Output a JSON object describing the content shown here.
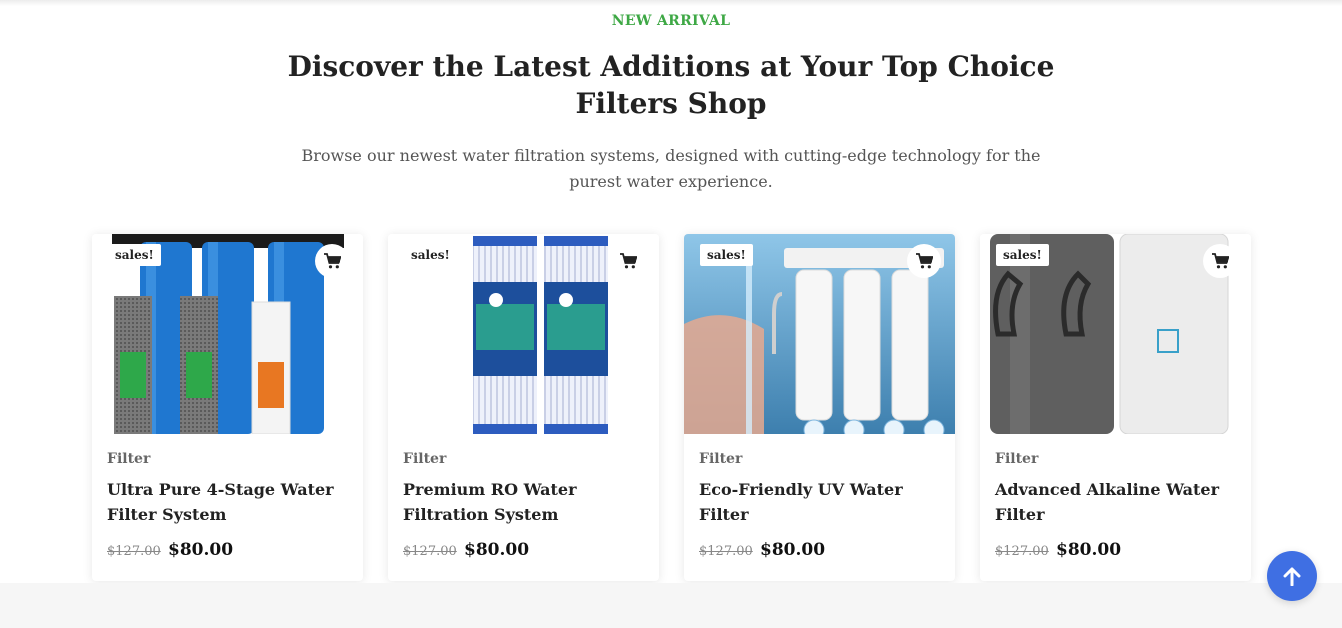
{
  "section": {
    "eyebrow": "NEW ARRIVAL",
    "title": "Discover the Latest Additions at Your Top Choice Filters Shop",
    "subtitle": "Browse our newest water filtration systems, designed with cutting-edge technology for the purest water experience."
  },
  "products": [
    {
      "badge": "sales!",
      "category": "Filter",
      "name": "Ultra Pure 4-Stage Water Filter System",
      "old_price": "$127.00",
      "price": "$80.00",
      "image_icon": "blue-housing-filters-image"
    },
    {
      "badge": "sales!",
      "category": "Filter",
      "name": "Premium RO Water Filtration System",
      "old_price": "$127.00",
      "price": "$80.00",
      "image_icon": "pleated-cartridges-image"
    },
    {
      "badge": "sales!",
      "category": "Filter",
      "name": "Eco-Friendly UV Water Filter",
      "old_price": "$127.00",
      "price": "$80.00",
      "image_icon": "ro-system-hand-image"
    },
    {
      "badge": "sales!",
      "category": "Filter",
      "name": "Advanced Alkaline Water Filter",
      "old_price": "$127.00",
      "price": "$80.00",
      "image_icon": "straw-bottles-image"
    }
  ],
  "colors": {
    "accent_green": "#3ea845",
    "scroll_button": "#3f6fe3"
  },
  "icons": {
    "cart": "cart-icon",
    "scroll_top": "arrow-up-icon"
  }
}
